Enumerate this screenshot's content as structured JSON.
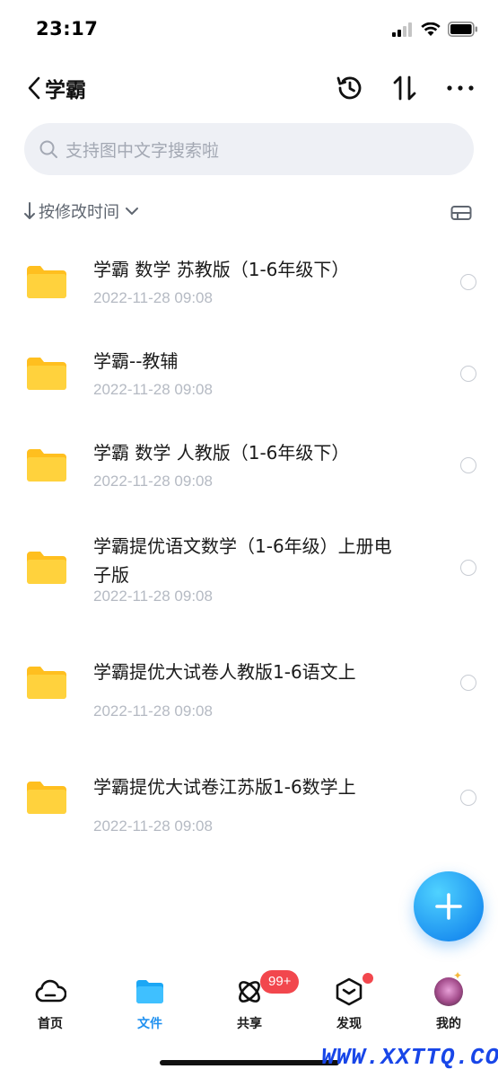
{
  "status_bar": {
    "time": "23:17"
  },
  "nav": {
    "title": "学霸"
  },
  "search": {
    "placeholder": "支持图中文字搜索啦"
  },
  "sort": {
    "label": "按修改时间"
  },
  "files": [
    {
      "name": "学霸 数学 苏教版（1-6年级下）",
      "date": "2022-11-28 09:08"
    },
    {
      "name": "学霸--教辅",
      "date": "2022-11-28 09:08"
    },
    {
      "name": "学霸 数学 人教版（1-6年级下）",
      "date": "2022-11-28 09:08"
    },
    {
      "name": "学霸提优语文数学（1-6年级）上册电子版",
      "date": "2022-11-28 09:08"
    },
    {
      "name": "学霸提优大试卷人教版1-6语文上",
      "date": "2022-11-28 09:08"
    },
    {
      "name": "学霸提优大试卷江苏版1-6数学上",
      "date": "2022-11-28 09:08"
    }
  ],
  "tabs": [
    {
      "label": "首页",
      "icon": "cloud-icon"
    },
    {
      "label": "文件",
      "icon": "folder-icon"
    },
    {
      "label": "共享",
      "icon": "share-orbit-icon"
    },
    {
      "label": "发现",
      "icon": "discover-box-icon"
    },
    {
      "label": "我的",
      "icon": "avatar"
    }
  ],
  "badges": {
    "share_count": "99+"
  },
  "watermark": "WWW.XXTTQ.COM",
  "colors": {
    "accent": "#1e90f0",
    "folder": "#ffc929",
    "badge": "#f2474d"
  }
}
